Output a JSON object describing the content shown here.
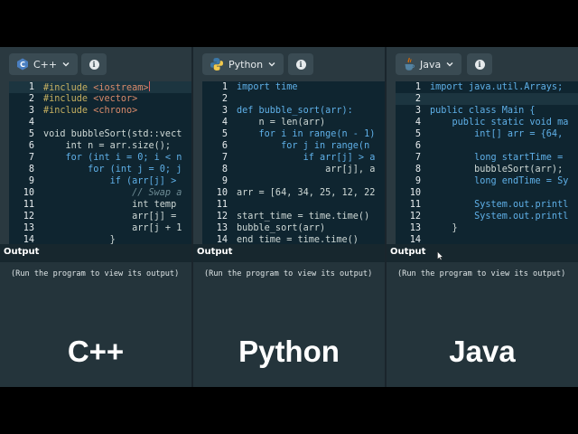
{
  "panels": [
    {
      "language": "C++",
      "icon": "cpp-logo-icon",
      "output_label": "Output",
      "output_message": "(Run the program to view its output)",
      "big_title": "C++",
      "lines": [
        {
          "n": "1",
          "text": "#include <iostream>"
        },
        {
          "n": "2",
          "text": "#include <vector>"
        },
        {
          "n": "3",
          "text": "#include <chrono>"
        },
        {
          "n": "4",
          "text": ""
        },
        {
          "n": "5",
          "text": "void bubbleSort(std::vect"
        },
        {
          "n": "6",
          "text": "    int n = arr.size();"
        },
        {
          "n": "7",
          "text": "    for (int i = 0; i < n"
        },
        {
          "n": "8",
          "text": "        for (int j = 0; j"
        },
        {
          "n": "9",
          "text": "            if (arr[j] > "
        },
        {
          "n": "10",
          "text": "                // Swap a"
        },
        {
          "n": "11",
          "text": "                int temp "
        },
        {
          "n": "12",
          "text": "                arr[j] = "
        },
        {
          "n": "13",
          "text": "                arr[j + 1"
        },
        {
          "n": "14",
          "text": "            }"
        }
      ]
    },
    {
      "language": "Python",
      "icon": "python-logo-icon",
      "output_label": "Output",
      "output_message": "(Run the program to view its output)",
      "big_title": "Python",
      "lines": [
        {
          "n": "1",
          "text": "import time"
        },
        {
          "n": "2",
          "text": ""
        },
        {
          "n": "3",
          "text": "def bubble_sort(arr):"
        },
        {
          "n": "4",
          "text": "    n = len(arr)"
        },
        {
          "n": "5",
          "text": "    for i in range(n - 1)"
        },
        {
          "n": "6",
          "text": "        for j in range(n"
        },
        {
          "n": "7",
          "text": "            if arr[j] > a"
        },
        {
          "n": "8",
          "text": "                arr[j], a"
        },
        {
          "n": "9",
          "text": ""
        },
        {
          "n": "10",
          "text": "arr = [64, 34, 25, 12, 22"
        },
        {
          "n": "11",
          "text": ""
        },
        {
          "n": "12",
          "text": "start_time = time.time()"
        },
        {
          "n": "13",
          "text": "bubble_sort(arr)"
        },
        {
          "n": "14",
          "text": "end_time = time.time()"
        }
      ]
    },
    {
      "language": "Java",
      "icon": "java-logo-icon",
      "output_label": "Output",
      "output_message": "(Run the program to view its output)",
      "big_title": "Java",
      "lines": [
        {
          "n": "1",
          "text": "import java.util.Arrays;"
        },
        {
          "n": "2",
          "text": ""
        },
        {
          "n": "3",
          "text": "public class Main {"
        },
        {
          "n": "4",
          "text": "    public static void ma"
        },
        {
          "n": "5",
          "text": "        int[] arr = {64, "
        },
        {
          "n": "6",
          "text": ""
        },
        {
          "n": "7",
          "text": "        long startTime = "
        },
        {
          "n": "8",
          "text": "        bubbleSort(arr);"
        },
        {
          "n": "9",
          "text": "        long endTime = Sy"
        },
        {
          "n": "10",
          "text": ""
        },
        {
          "n": "11",
          "text": "        System.out.printl"
        },
        {
          "n": "12",
          "text": "        System.out.printl"
        },
        {
          "n": "13",
          "text": "    }"
        },
        {
          "n": "14",
          "text": ""
        }
      ]
    }
  ],
  "colors": {
    "background": "#1a252c",
    "panel": "#2a3940",
    "editor": "#0f2530",
    "keyword": "#5fb0e8",
    "preprocessor": "#c6b060",
    "string": "#d98a6a"
  }
}
